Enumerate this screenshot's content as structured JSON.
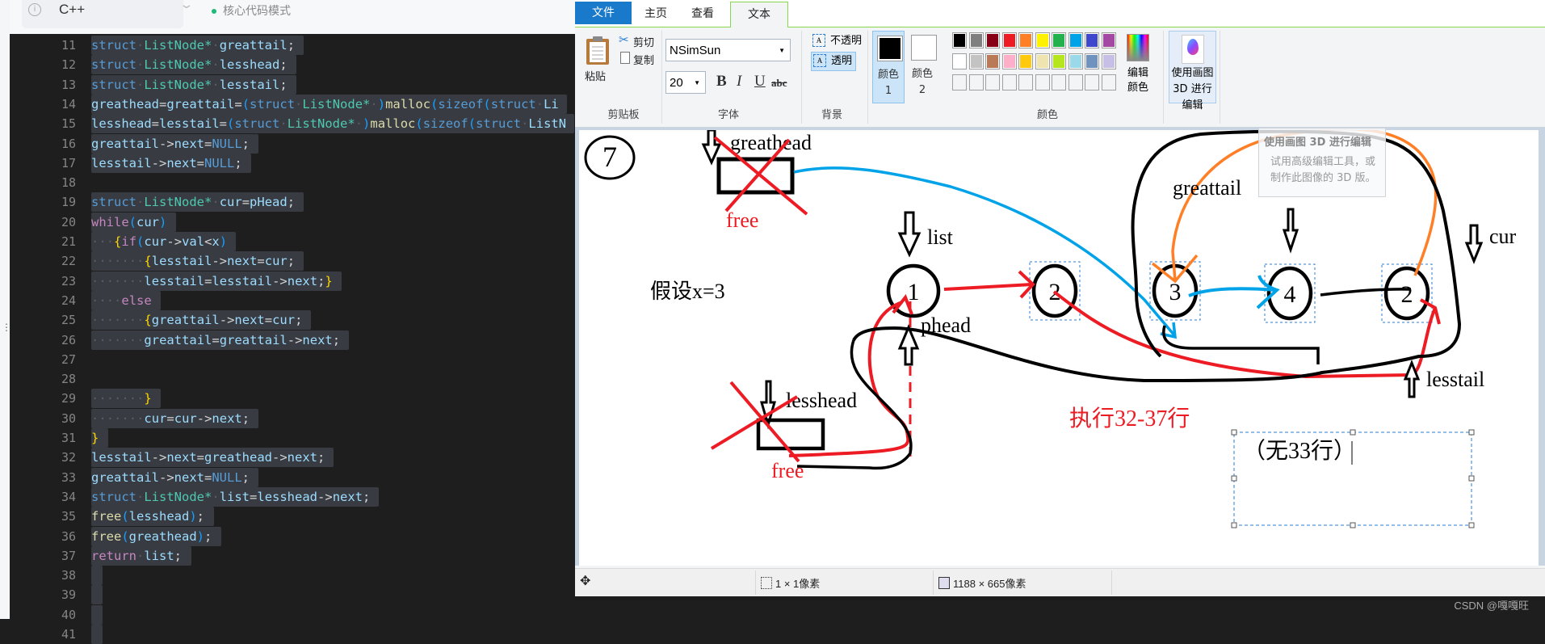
{
  "editor": {
    "language": "C++",
    "mode_label": "核心代码模式",
    "lines": [
      {
        "n": "11",
        "code": "struct ListNode* greattail;"
      },
      {
        "n": "12",
        "code": "struct ListNode* lesshead;"
      },
      {
        "n": "13",
        "code": "struct ListNode* lesstail;"
      },
      {
        "n": "14",
        "code": "greathead=greattail=(struct ListNode* )malloc(sizeof(struct Li"
      },
      {
        "n": "15",
        "code": "lesshead=lesstail=(struct ListNode* )malloc(sizeof(struct ListN"
      },
      {
        "n": "16",
        "code": "greattail->next=NULL;"
      },
      {
        "n": "17",
        "code": "lesstail->next=NULL;"
      },
      {
        "n": "18",
        "code": ""
      },
      {
        "n": "19",
        "code": "struct ListNode* cur=pHead;"
      },
      {
        "n": "20",
        "code": "while(cur)"
      },
      {
        "n": "21",
        "code": "   {if(cur->val<x)"
      },
      {
        "n": "22",
        "code": "       {lesstail->next=cur;"
      },
      {
        "n": "23",
        "code": "       lesstail=lesstail->next;}"
      },
      {
        "n": "24",
        "code": "    else"
      },
      {
        "n": "25",
        "code": "       {greattail->next=cur;"
      },
      {
        "n": "26",
        "code": "       greattail=greattail->next;"
      },
      {
        "n": "27",
        "code": ""
      },
      {
        "n": "28",
        "code": ""
      },
      {
        "n": "29",
        "code": "       }"
      },
      {
        "n": "30",
        "code": "       cur=cur->next;"
      },
      {
        "n": "31",
        "code": "}"
      },
      {
        "n": "32",
        "code": "lesstail->next=greathead->next;"
      },
      {
        "n": "33",
        "code": "greattail->next=NULL;"
      },
      {
        "n": "34",
        "code": "struct ListNode* list=lesshead->next;"
      },
      {
        "n": "35",
        "code": "free(lesshead);"
      },
      {
        "n": "36",
        "code": "free(greathead);"
      },
      {
        "n": "37",
        "code": "return list;"
      },
      {
        "n": "38",
        "code": ""
      },
      {
        "n": "39",
        "code": ""
      },
      {
        "n": "40",
        "code": ""
      },
      {
        "n": "41",
        "code": ""
      }
    ]
  },
  "paint": {
    "tabs": {
      "file": "文件",
      "home": "主页",
      "view": "查看",
      "text": "文本"
    },
    "clipboard": {
      "paste": "粘贴",
      "cut": "剪切",
      "copy": "复制",
      "group": "剪贴板"
    },
    "font": {
      "family": "NSimSun",
      "size": "20",
      "bold": "B",
      "italic": "I",
      "underline": "U",
      "strike": "abc",
      "group": "字体"
    },
    "background": {
      "opaque": "不透明",
      "transparent": "透明",
      "group": "背景"
    },
    "colors": {
      "color1_label": "颜色 1",
      "color2_label": "颜色 2",
      "color1": "#000000",
      "color2": "#ffffff",
      "edit_colors": "编辑颜色",
      "group": "颜色",
      "palette_row1": [
        "#000000",
        "#7f7f7f",
        "#880015",
        "#ed1c24",
        "#ff7f27",
        "#fff200",
        "#22b14c",
        "#00a2e8",
        "#3f48cc",
        "#a349a4"
      ],
      "palette_row2": [
        "#ffffff",
        "#c3c3c3",
        "#b97a57",
        "#ffaec9",
        "#ffc90e",
        "#efe4b0",
        "#b5e61d",
        "#99d9ea",
        "#7092be",
        "#c8bfe7"
      ]
    },
    "paint3d": {
      "label": "使用画图 3D 进行编辑"
    },
    "tooltip": {
      "title": "使用画图 3D 进行编辑",
      "body": "试用高级编辑工具，或制作此图像的 3D 版。"
    },
    "status": {
      "selection": "1 × 1像素",
      "image_size": "1188 × 665像素"
    },
    "canvas": {
      "step_number": "7",
      "assume": "假设x=3",
      "greathead": "greathead",
      "lesshead": "lesshead",
      "free1": "free",
      "free2": "free",
      "list": "list",
      "phead": "phead",
      "greattail": "greattail",
      "cur": "cur",
      "lesstail": "lesstail",
      "exec_note": "执行32-37行",
      "textbox": "（无33行）",
      "nodes": [
        "1",
        "2",
        "3",
        "4",
        "2"
      ]
    }
  },
  "watermark": "CSDN @嘎嘎旺"
}
